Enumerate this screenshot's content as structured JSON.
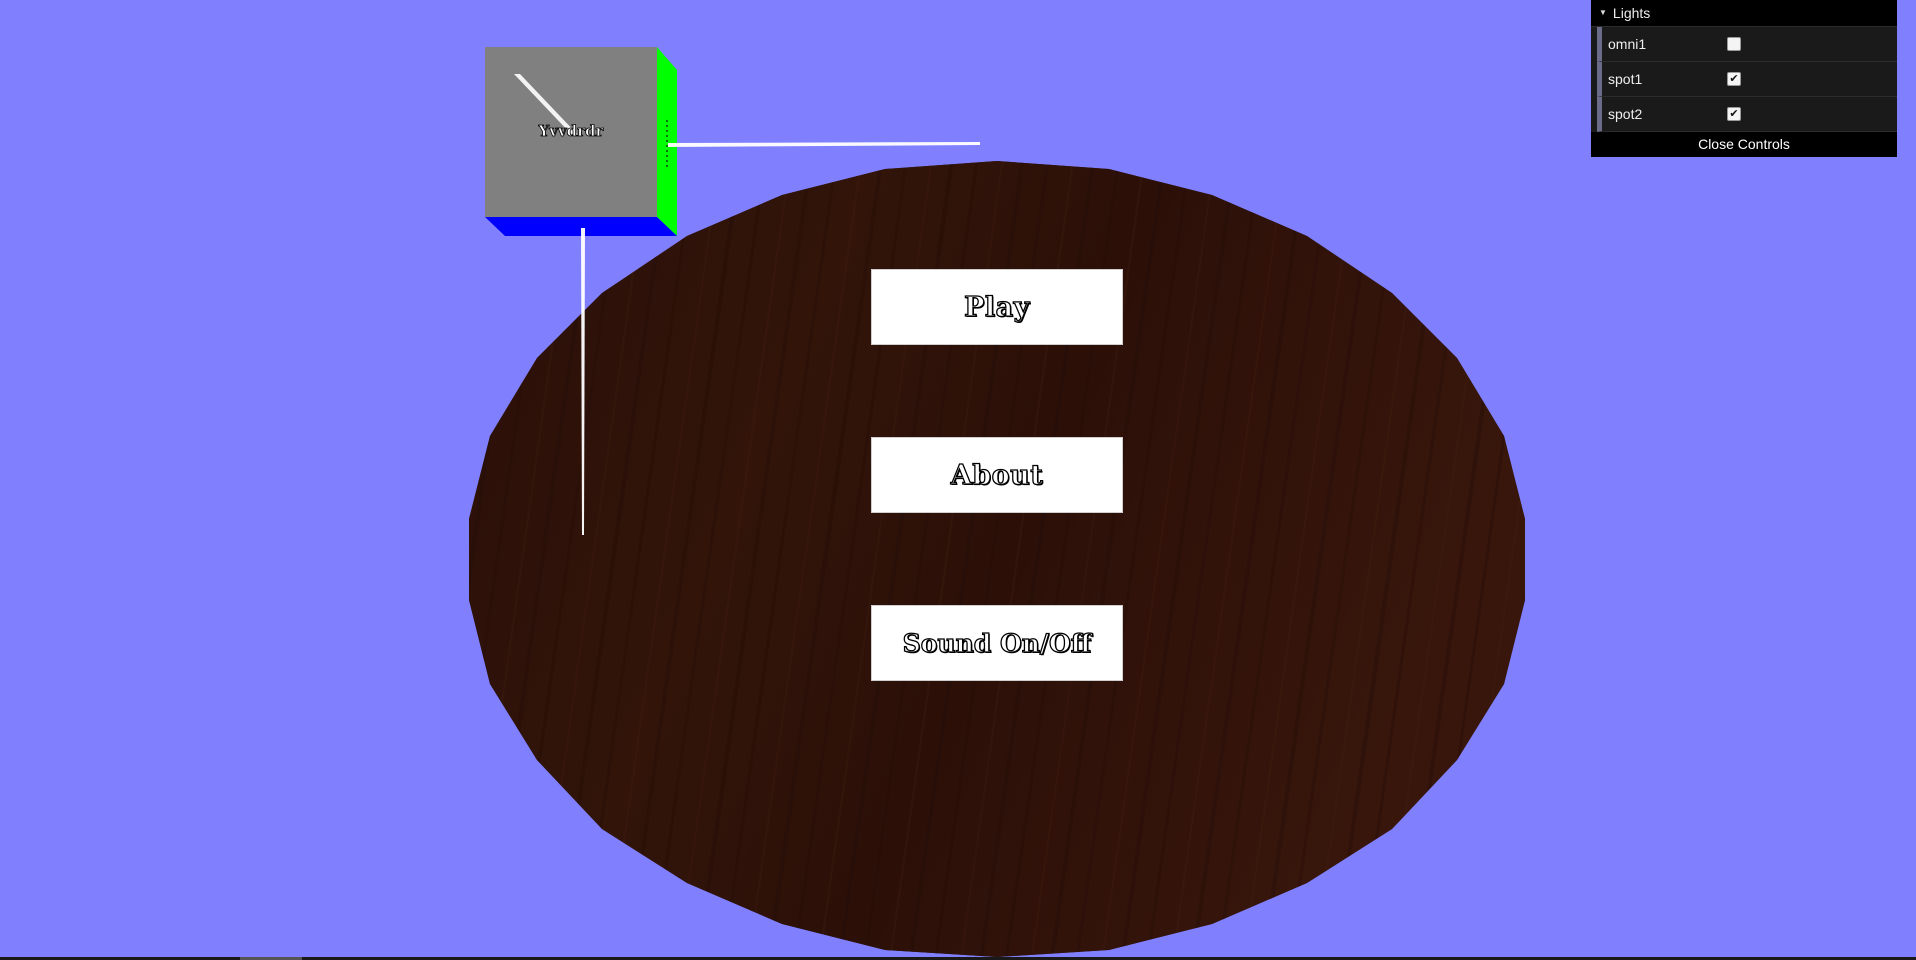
{
  "scene": {
    "background_color": "#8080ff",
    "table_color": "#2b110a",
    "cube": {
      "front_color": "#808080",
      "right_color": "#00ff00",
      "bottom_color": "#0000ff",
      "label": "Yvvdrdr"
    }
  },
  "menu": {
    "play_label": "Play",
    "about_label": "About",
    "sound_label": "Sound On/Off"
  },
  "gui": {
    "folder_title": "Lights",
    "lights": [
      {
        "label": "omni1",
        "checked": false
      },
      {
        "label": "spot1",
        "checked": true
      },
      {
        "label": "spot2",
        "checked": true
      }
    ],
    "close_label": "Close Controls"
  }
}
